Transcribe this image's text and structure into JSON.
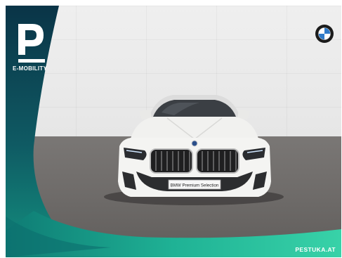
{
  "overlay": {
    "logo_letter": "P",
    "tagline": "E-MOBILITY",
    "dealer": "PESTUKA.AT"
  },
  "car": {
    "plate_text": "BMW Premium Selection",
    "badge": "bmw-roundel-icon"
  },
  "colors": {
    "teal_dark": "#0a3a4a",
    "teal": "#1aa89a",
    "teal_light": "#3fd6b0",
    "car_body": "#f4f4f2",
    "grille": "#2b2b2b"
  }
}
